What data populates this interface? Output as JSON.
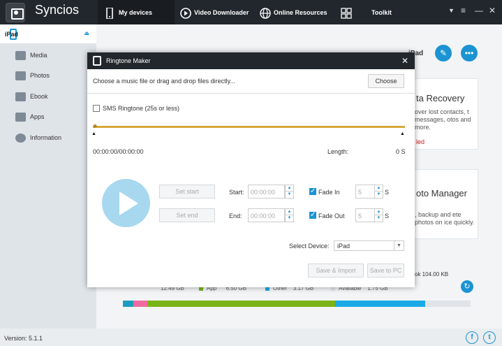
{
  "app": {
    "name": "Syncios",
    "version": "Version: 5.1.1"
  },
  "nav": {
    "tabs": [
      {
        "label": "My devices",
        "icon": "phone-icon"
      },
      {
        "label": "Video Downloader",
        "icon": "play-circle-icon"
      },
      {
        "label": "Online Resources",
        "icon": "globe-icon"
      },
      {
        "label": "Toolkit",
        "icon": "grid-icon"
      }
    ],
    "window_controls": [
      "▼",
      "≡",
      "—",
      "✕"
    ]
  },
  "sidebar": {
    "device": "iPad",
    "items": [
      {
        "label": "Media",
        "icon": "tv-icon"
      },
      {
        "label": "Photos",
        "icon": "photo-icon"
      },
      {
        "label": "Ebook",
        "icon": "book-icon"
      },
      {
        "label": "Apps",
        "icon": "apps-icon"
      },
      {
        "label": "Information",
        "icon": "info-icon"
      }
    ]
  },
  "main": {
    "device_title": "iPad",
    "card1": {
      "title": "ta Recovery",
      "text": "over lost contacts, t messages, otos and more.",
      "red": "led"
    },
    "card2": {
      "title": "oto Manager",
      "text": ", backup and ete photos on ice quickly."
    },
    "storage": {
      "ebook": "ok   104.00 KB",
      "used": "12.49 GB",
      "app_label": "App",
      "app_value": "6.50 GB",
      "other_label": "Other",
      "other_value": "3.17 GB",
      "available_label": "Available",
      "available_value": "1.75 GB",
      "segments": [
        {
          "color": "#1b9cbd",
          "fraction": 0.03
        },
        {
          "color": "#f06aa0",
          "fraction": 0.04
        },
        {
          "color": "#7ab317",
          "fraction": 0.54
        },
        {
          "color": "#1aa9e6",
          "fraction": 0.26
        },
        {
          "color": "#e0e4e8",
          "fraction": 0.13
        }
      ]
    }
  },
  "dialog": {
    "title": "Ringtone Maker",
    "instruction": "Choose a music file or drag and drop files directly...",
    "choose_label": "Choose",
    "sms_label": "SMS Ringtone (25s or less)",
    "time": "00:00:00/00:00:00",
    "length_label": "Length:",
    "length_value": "0 S",
    "set_start_label": "Set start",
    "set_end_label": "Set end",
    "start_label": "Start:",
    "end_label": "End:",
    "start_placeholder": "00:00:00",
    "end_placeholder": "00:00:00",
    "fade_in_label": "Fade In",
    "fade_out_label": "Fade Out",
    "fade_in_value": "5",
    "fade_out_value": "5",
    "unit": "S",
    "select_device_label": "Select Device:",
    "device_value": "iPad",
    "save_import_label": "Save & Import",
    "save_pc_label": "Save to PC"
  }
}
